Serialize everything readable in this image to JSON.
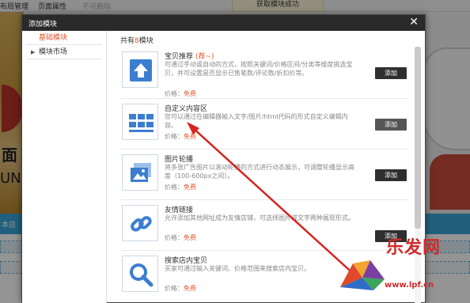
{
  "topbar": {
    "items": [
      "布局管理",
      "页面属性",
      "不可删除"
    ],
    "toast": "获取模块成功"
  },
  "background": {
    "left_text_1": "面",
    "left_text_2": "UN",
    "blue_bar_text": "本店"
  },
  "modal": {
    "title": "添加模块",
    "close_label": "✕",
    "sidebar": [
      {
        "label": "基础模块",
        "active": true
      },
      {
        "label": "模块市场",
        "active": false
      }
    ],
    "count_prefix": "共有",
    "count_num": "8",
    "count_suffix": "模块",
    "price_label": "价格：",
    "free_label": "免费",
    "add_label": "添加",
    "modules": [
      {
        "name": "宝贝推荐",
        "tag": "(荐~)",
        "desc": "可通过手动或自动的方式，按照关键词/价格区间/分类等维度挑选宝贝，并可设置是否显示已售笔数/评论数/折扣价等。",
        "icon": "upload-arrow-icon"
      },
      {
        "name": "自定义内容区",
        "tag": "",
        "desc": "您可以通过在编辑器输入文字/图片/html代码的形式自定义编辑内容。",
        "icon": "grid-layout-icon"
      },
      {
        "name": "图片轮播",
        "tag": "",
        "desc": "将多张广告图片以滚动轮播的方式进行动态展示，可调整轮播显示高度（100-600px之间）。",
        "icon": "image-carousel-icon"
      },
      {
        "name": "友情链接",
        "tag": "",
        "desc": "允许添加其他网址成为友情店铺，可选择图片或文字两种展现形式。",
        "icon": "link-chain-icon"
      },
      {
        "name": "搜索店内宝贝",
        "tag": "",
        "desc": "买家可通过输入关键词、价格范围来搜索店内宝贝。",
        "icon": "search-magnifier-icon"
      }
    ]
  },
  "watermark": {
    "brand": "乐发网",
    "url": "www.lpf.cn"
  },
  "colors": {
    "accent": "#e4572e",
    "header_dark": "#2a2a2a",
    "button_dark": "#2f2f2f",
    "icon_blue": "#3b7ed0",
    "annotation_red": "#d8231f"
  }
}
